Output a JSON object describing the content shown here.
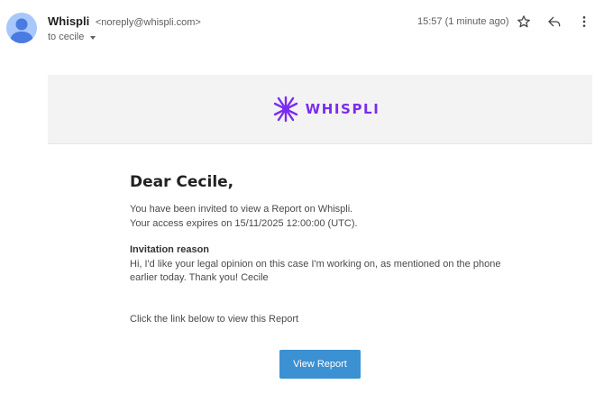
{
  "header": {
    "sender_name": "Whispli",
    "sender_email": "<noreply@whispli.com>",
    "recipient_label": "to cecile",
    "timestamp": "15:57 (1 minute ago)",
    "icons": [
      "avatar-icon",
      "star-icon",
      "reply-icon",
      "more-vert-icon",
      "chevron-down-icon"
    ]
  },
  "email": {
    "logo_text": "WHISPLI",
    "brand_color": "#7b2cf0",
    "greeting": "Dear Cecile,",
    "intro_line1": "You have been invited to view a Report on Whispli.",
    "intro_line2": "Your access expires on 15/11/2025 12:00:00 (UTC).",
    "reason_title": "Invitation reason",
    "reason_line1": "Hi, I'd like your legal opinion on this case I'm working on, as mentioned on the phone",
    "reason_line2": "earlier today. Thank you! Cecile",
    "cta_text": "Click the link below to view this Report",
    "button_label": "View Report",
    "button_color": "#3b91d1"
  }
}
